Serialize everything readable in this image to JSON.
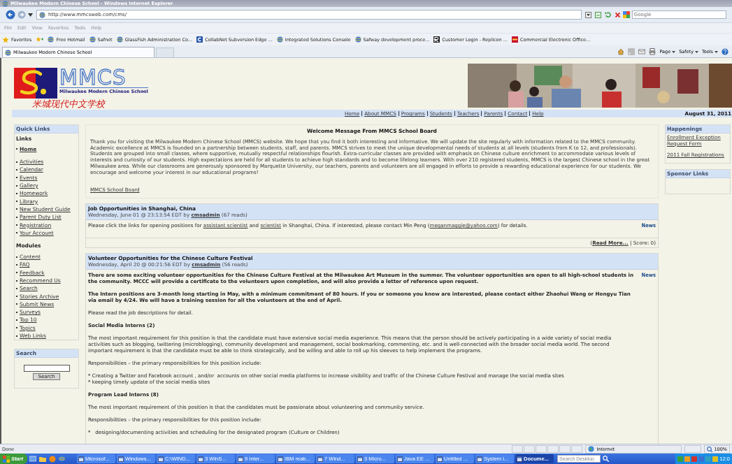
{
  "browser": {
    "title": "Milwaukee Modern Chinese School - Windows Internet Explorer",
    "address": "http://www.mmcsweb.com/cms/",
    "search_placeholder": "Google",
    "menu": [
      "File",
      "Edit",
      "View",
      "Favorites",
      "Tools",
      "Help"
    ],
    "favorites_label": "Favorites",
    "favorites": [
      {
        "label": "Free Hotmail",
        "kind": "ie"
      },
      {
        "label": "Safnet",
        "kind": "ie"
      },
      {
        "label": "GlassFish Administration Co...",
        "kind": "ie"
      },
      {
        "label": "CollabNet Subversion Edge ...",
        "kind": "collabnet"
      },
      {
        "label": "Integrated Solutions Console",
        "kind": "ie"
      },
      {
        "label": "Safway development proce...",
        "kind": "ie"
      },
      {
        "label": "Customer Login - Replicon ...",
        "kind": "replicon"
      },
      {
        "label": "Commercial Electronic Office...",
        "kind": "wf"
      }
    ],
    "tab": "Milwaukee Modern Chinese School",
    "commands": [
      "Page",
      "Safety",
      "Tools"
    ]
  },
  "header": {
    "logo_text": "MMCS",
    "school_name": "Milwaukee Modern Chinese School",
    "chinese_name": "米城现代中文学校"
  },
  "nav": {
    "links": [
      "Home",
      "About MMCS",
      "Programs",
      "Students",
      "Teachers",
      "Parents",
      "Contact",
      "Help"
    ],
    "date": "August 31, 2011"
  },
  "quick_links": {
    "title": "Quick Links",
    "sections": [
      {
        "heading": "Links",
        "items": [
          {
            "label": "Home",
            "selected": true
          },
          {
            "label": "Activities",
            "selected": false
          },
          {
            "label": "Calendar",
            "selected": false
          },
          {
            "label": "Events",
            "selected": false
          },
          {
            "label": "Gallery",
            "selected": false
          },
          {
            "label": "Homework",
            "selected": false
          },
          {
            "label": "Library",
            "selected": false
          },
          {
            "label": "New Student Guide",
            "selected": false
          },
          {
            "label": "Parent Duty List",
            "selected": false
          },
          {
            "label": "Registration",
            "selected": false
          },
          {
            "label": "Your Account",
            "selected": false
          }
        ]
      },
      {
        "heading": "Modules",
        "items": [
          {
            "label": "Content",
            "selected": false
          },
          {
            "label": "FAQ",
            "selected": false
          },
          {
            "label": "Feedback",
            "selected": false
          },
          {
            "label": "Recommend Us",
            "selected": false
          },
          {
            "label": "Search",
            "selected": false
          },
          {
            "label": "Stories Archive",
            "selected": false
          },
          {
            "label": "Submit News",
            "selected": false
          },
          {
            "label": "Surveys",
            "selected": false
          },
          {
            "label": "Top 10",
            "selected": false
          },
          {
            "label": "Topics",
            "selected": false
          },
          {
            "label": "Web Links",
            "selected": false
          }
        ]
      }
    ]
  },
  "search_box": {
    "title": "Search",
    "button": "Search"
  },
  "welcome": {
    "title": "Welcome Message From MMCS School Board",
    "text": "Thank you for visiting the Milwaukee Modern Chinese School (MMCS) website. We hope that you find it both interesting and informative. We will update the site regularly with information related to the MMCS community. Academic excellence at MMCS is founded on a partnership between students, staff, and parents. MMCS strives to meet the unique developmental needs of students at all levels (students from K to 12, and professionals). Students are grouped into small classes, where supportive, mutually respectful relationships flourish. Extra-curricular classes are provided with emphasis on Chinese culture enrichment to accommodate various levels of interests and curiosity of our students. High expectations are held for all students to achieve high standards and to become lifelong learners. With over 210 registered students, MMCS is the largest Chinese school in the great Milwaukee area. While our classrooms are generously sponsored by Marquette University, our teachers, parents and volunteers are all engaged in efforts to provide a rewarding educational experience for our students. We encourage and welcome your interest in our educational programs!",
    "link": "MMCS School Board"
  },
  "stories": [
    {
      "title": "Job Opportunities in Shanghai, China",
      "date": "Wednesday, June 01 @ 23:13:54 EDT by",
      "author": "cmsadmin",
      "reads": "(67 reads)",
      "topic": "News",
      "body": [
        {
          "kind": "text",
          "parts": [
            {
              "text": "Please click the links for opening positions for "
            },
            {
              "link": "assistant scientist"
            },
            {
              "text": " and "
            },
            {
              "link": "scientist"
            },
            {
              "text": " in Shanghai, China.  If interested, please contact Min Peng ("
            },
            {
              "link": "meganmaggie@yahoo.com"
            },
            {
              "text": ") for details."
            }
          ]
        }
      ],
      "footer": [
        {
          "text": "("
        },
        {
          "link": "Read More..."
        },
        {
          "text": " | Score: 0)"
        }
      ]
    },
    {
      "title": "Volunteer Opportunities for the Chinese Culture Festival",
      "date": "Wednesday, April 20 @ 00:21:56 EDT by",
      "author": "cmsadmin",
      "reads": "(56 reads)",
      "topic": "News",
      "body": [
        {
          "kind": "bold",
          "parts": [
            {
              "text": "There are some exciting volunteer opportunities for the Chinese Culture Festival at the Milwaukee Art Museum in the summer.  The volunteer opportunities are open to all high-school students in the community.  MCCC will provide a certificate to the volunteers upon completion, and will also provide a letter of reference upon request."
            }
          ]
        },
        {
          "kind": "bold",
          "parts": [
            {
              "text": "The Intern positions are 3-month long starting in May, with a minimum commitment of 80 hours. If you or someone you know are interested, please contact either Zhaohui Wang or Hongyu Tian via email by 4/24. We will have a training session for all the volunteers at the end of April."
            }
          ]
        },
        {
          "kind": "text",
          "parts": [
            {
              "text": "Please read the job descriptions for detail."
            }
          ]
        },
        {
          "kind": "heading",
          "parts": [
            {
              "text": "Social Media Interns (2)"
            }
          ]
        },
        {
          "kind": "text",
          "parts": [
            {
              "text": "The most important requirement for this position is that the candidate must have extensive social media experience. This means that the person should be actively participating in a wide variety of social media activities such as blogging, twittering (microblogging), community development and management, social bookmarking, commenting, etc. and is well-connected with the broader social media world. The second important requirement is that the candidate must be able to think strategically, and be willing and able to roll up his sleeves to help implement the programs."
            }
          ]
        },
        {
          "kind": "text",
          "parts": [
            {
              "text": "Responsibilities – the primary responsibilities for this position include:"
            }
          ]
        },
        {
          "kind": "list",
          "lines": [
            "* Creating a Twitter and Facebook account , and/or  accounts on other social media platforms to increase visibility and traffic of the Chinese Culture Festival and manage the social media sites",
            "* keeping timely update of the social media sites"
          ]
        },
        {
          "kind": "heading",
          "parts": [
            {
              "text": "Program Lead Interns (8)"
            }
          ]
        },
        {
          "kind": "text",
          "parts": [
            {
              "text": "The most important requirement of this position is that the candidates must be passionate about volunteering and community service."
            }
          ]
        },
        {
          "kind": "text",
          "parts": [
            {
              "text": "Responsibilities – the primary responsibilities for this position include:"
            }
          ]
        },
        {
          "kind": "list",
          "lines": [
            "*   designing/documenting activities and scheduling for the designated program (Culture or Children)"
          ]
        }
      ]
    }
  ],
  "happenings": {
    "title": "Happenings",
    "links": [
      "Enrollment Exception Request Form",
      "2011 Fall Registrations"
    ]
  },
  "sponsor": {
    "title": "Sponsor Links"
  },
  "status_bar": {
    "text": "Done",
    "zone": "Internet",
    "zoom": "100%"
  },
  "taskbar": {
    "start": "Start",
    "items": [
      {
        "label": "Microsof...",
        "selected": false
      },
      {
        "label": "Windows...",
        "selected": false
      },
      {
        "label": "C:\\WIND...",
        "selected": false
      },
      {
        "label": "3 WinS...",
        "selected": false
      },
      {
        "label": "9 Inter...",
        "selected": false
      },
      {
        "label": "IBM reab...",
        "selected": false
      },
      {
        "label": "7 Wind...",
        "selected": false
      },
      {
        "label": "3 Micro...",
        "selected": false
      },
      {
        "label": "Java EE ...",
        "selected": false
      },
      {
        "label": "Untitled ...",
        "selected": false
      },
      {
        "label": "System i...",
        "selected": false
      },
      {
        "label": "Docume...",
        "selected": true
      }
    ],
    "placeholder": "Search Desktop",
    "clock": "12:0"
  }
}
